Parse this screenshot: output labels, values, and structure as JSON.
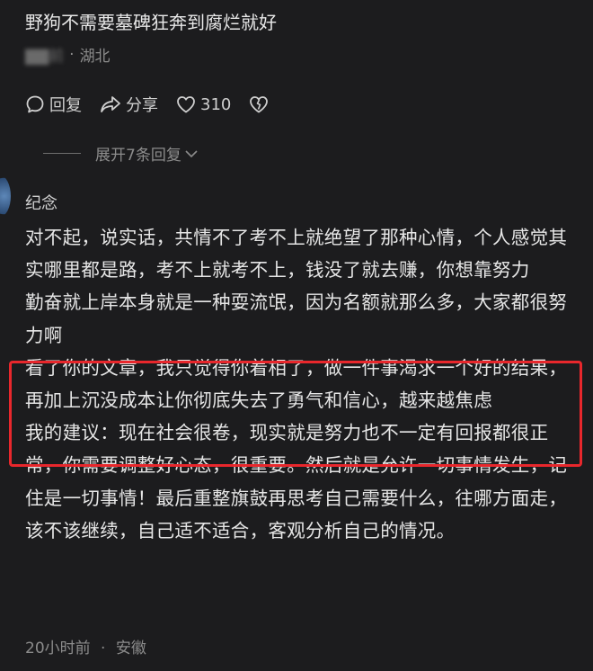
{
  "comment": {
    "text": "野狗不需要墓碑狂奔到腐烂就好",
    "author_blurred": "前",
    "location": "湖北"
  },
  "actions": {
    "reply_label": "回复",
    "share_label": "分享",
    "like_count": "310"
  },
  "expand_label": "展开7条回复",
  "reply": {
    "author": "纪念",
    "paragraphs": [
      "对不起，说实话，共情不了考不上就绝望了那种心情，个人感觉其实哪里都是路，考不上就考不上，钱没了就去赚，你想靠努力　　勤奋就上岸本身就是一种耍流氓，因为名额就那么多，大家都很努力啊",
      "看了你的文章，我只觉得你着相了，做一件事渴求一个好的结果，再加上沉没成本让你彻底失去了勇气和信心，越来越焦虑",
      "我的建议：现在社会很卷，现实就是努力也不一定有回报都很正常，你需要调整好心态，很重要。然后就是允许一切事情发生，记住是一切事情！最后重整旗鼓再思考自己需要什么，往哪方面走，该不该继续，自己适不适合，客观分析自己的情况。"
    ],
    "time": "20小时前",
    "location": "安徽"
  },
  "colors": {
    "background": "#1c1c1e",
    "highlight_border": "#e8272c"
  }
}
